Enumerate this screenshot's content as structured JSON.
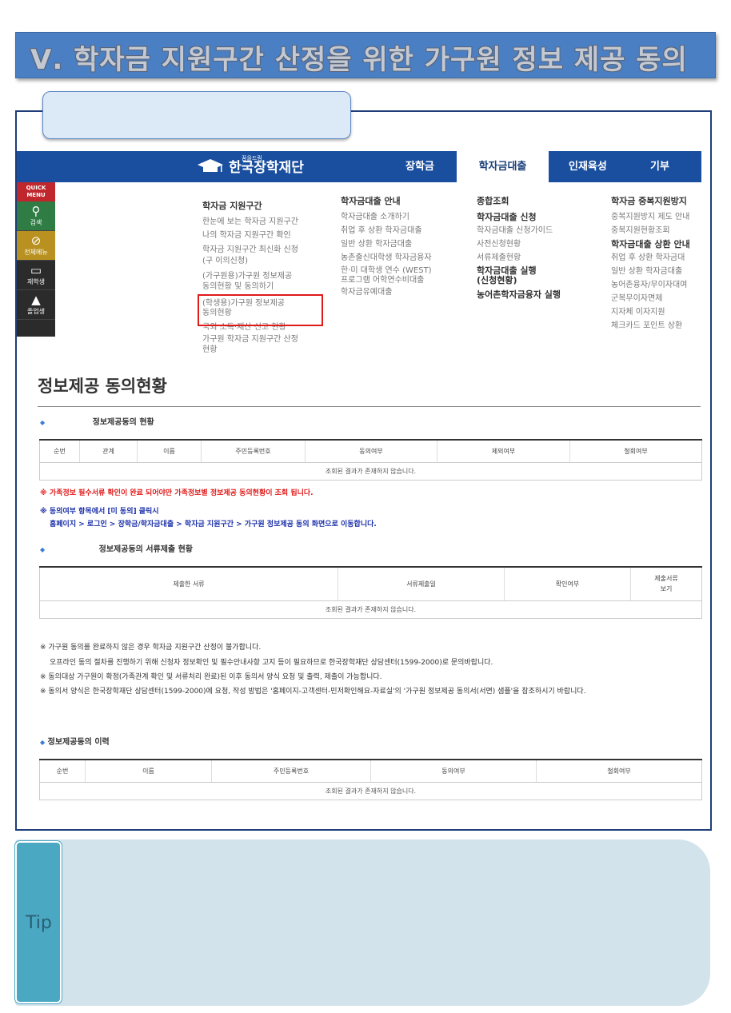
{
  "banner": {
    "title": "Ⅴ. 학자금 지원구간 산정을 위한 가구원 정보 제공 동의"
  },
  "site": {
    "logo_sub": "꿈을드림",
    "logo_text": "한국장학재단",
    "nav": [
      "장학금",
      "학자금대출",
      "인재육성",
      "기부"
    ]
  },
  "quick_menu": {
    "header": "QUICK MENU",
    "items": [
      {
        "icon": "search-icon",
        "label": "검색"
      },
      {
        "icon": "compass-icon",
        "label": "전체메뉴"
      },
      {
        "icon": "book-icon",
        "label": "재학생"
      },
      {
        "icon": "graduation-cap-icon",
        "label": "졸업생"
      }
    ]
  },
  "menu": {
    "col1": {
      "heading": "학자금 지원구간",
      "items": [
        "한눈에 보는 학자금 지원구간",
        "나의 학자금 지원구간 확인",
        "학자금 지원구간 최신화 신청",
        "(구 이의신청)",
        "(가구원용)가구원 정보제공",
        "동의현황 및 동의하기",
        "(학생용)가구원 정보제공",
        "동의현황",
        "국외 소득·재산 신고 현황",
        "가구원 학자금 지원구간 산정",
        "현황"
      ]
    },
    "col2": {
      "heading": "학자금대출 안내",
      "items": [
        "학자금대출 소개하기",
        "취업 후 상환 학자금대출",
        "일반 상환 학자금대출",
        "농촌출신대학생 학자금융자",
        "한·미 대학생 연수 (WEST)",
        "프로그램 어학연수비대출",
        "학자금유예대출"
      ]
    },
    "col3": {
      "heading": "종합조회",
      "items": [
        "학자금대출 신청",
        "학자금대출 신청가이드",
        "사전신청현황",
        "서류제출현황",
        "학자금대출 실행",
        "(신청현황)",
        "농어촌학자금융자 실행"
      ]
    },
    "col4": {
      "heading": "학자금 중복지원방지",
      "items": [
        "중복지원방지 제도 안내",
        "중복지원현황조회",
        "학자금대출 상환 안내",
        "취업 후 상환 학자금대",
        "일반 상환 학자금대출",
        "농어촌융자/무이자대여",
        "군복무이자면제",
        "지자체 이자지원",
        "체크카드 포인트 상환"
      ]
    }
  },
  "page": {
    "title": "정보제공 동의현황",
    "sec1": {
      "heading": "정보제공동의 현황",
      "columns": [
        "순번",
        "관계",
        "이름",
        "주민등록번호",
        "동의여부",
        "제외여부",
        "철회여부"
      ],
      "empty": "조회된 결과가 존재하지 않습니다."
    },
    "notice_red": "※ 가족정보 필수서류 확인이 완료 되어야만 가족정보별 정보제공 동의현황이 조회 됩니다.",
    "notice_blue1": "※ 동의여부 항목에서 [미 동의] 클릭시",
    "notice_blue2": "홈페이지 > 로그인 > 장학금/학자금대출 > 학자금 지원구간 > 가구원 정보제공 동의 화면으로 이동합니다.",
    "sec2": {
      "heading": "정보제공동의 서류제출 현황",
      "columns": [
        "제출한 서류",
        "서류제출일",
        "확인여부",
        "제출서류",
        "보기"
      ],
      "empty": "조회된 결과가 존재하지 않습니다."
    },
    "notes": [
      "※ 가구원 동의를 완료하지 않은 경우 학자금 지원구간 산정이 불가합니다.",
      "오프라인 동의 절차를 진행하기 위해 신청자 정보확인 및 필수안내사항 고지 등이 필요하므로 한국장학재단 상담센터(1599-2000)로 문의바랍니다.",
      "※ 동의대상 가구원이 확정(가족관계 확인 및 서류처리 완료)된 이후 동의서 양식 요청 및 출력, 제출이 가능합니다.",
      "※ 동의서 양식은 한국장학재단 상담센터(1599-2000)에 요청, 작성 방법은 '홈페이지-고객센터-민저확인해요-자료실'의 '가구원 정보제공 동의서(서면) 샘플'을 참조하시기 바랍니다."
    ],
    "sec3": {
      "heading": "정보제공동의 이력",
      "columns": [
        "순번",
        "이름",
        "주민등록번호",
        "동의여부",
        "철회여부"
      ],
      "empty": "조회된 결과가 존재하지 않습니다."
    }
  },
  "tip": {
    "label": "Tip"
  }
}
